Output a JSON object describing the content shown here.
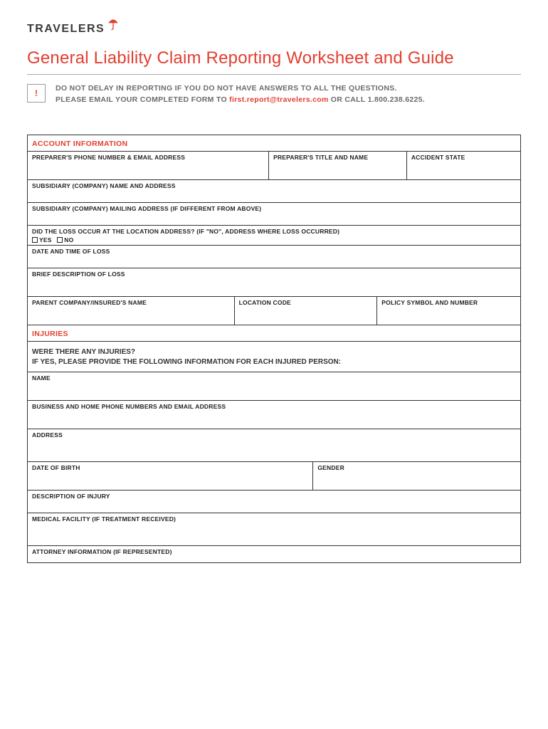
{
  "logo": {
    "text": "TRAVELERS"
  },
  "title": "General Liability Claim Reporting Worksheet and Guide",
  "notice": {
    "exclaim": "!",
    "line1": "DO NOT DELAY IN REPORTING IF YOU DO NOT HAVE ANSWERS TO ALL THE QUESTIONS.",
    "line2_pre": "PLEASE EMAIL YOUR COMPLETED FORM TO ",
    "email": "first.report@travelers.com",
    "line2_post": " OR CALL 1.800.238.6225."
  },
  "section1": {
    "header": "ACCOUNT INFORMATION",
    "preparer_phone_email": "PREPARER'S PHONE NUMBER & EMAIL ADDRESS",
    "preparer_title_name": "PREPARER'S TITLE AND NAME",
    "accident_state": "ACCIDENT STATE",
    "subsidiary_name_addr": "SUBSIDIARY (COMPANY) NAME AND ADDRESS",
    "subsidiary_mailing": "SUBSIDIARY (COMPANY) MAILING ADDRESS (IF DIFFERENT FROM ABOVE)",
    "loss_at_location": "DID THE LOSS OCCUR AT THE LOCATION ADDRESS? (IF \"NO\", ADDRESS WHERE LOSS OCCURRED)",
    "yes": "YES",
    "no": "NO",
    "date_time_loss": "DATE AND TIME OF LOSS",
    "brief_desc": "BRIEF DESCRIPTION OF LOSS",
    "parent_company": "PARENT COMPANY/INSURED'S NAME",
    "location_code": "LOCATION CODE",
    "policy_symbol": "POLICY SYMBOL AND NUMBER"
  },
  "section2": {
    "header": "INJURIES",
    "q_line1": "WERE THERE ANY INJURIES?",
    "q_line2": "IF YES, PLEASE PROVIDE THE FOLLOWING INFORMATION FOR EACH INJURED PERSON:",
    "name": "NAME",
    "contacts": "BUSINESS AND HOME PHONE NUMBERS AND EMAIL ADDRESS",
    "address": "ADDRESS",
    "dob": "DATE OF BIRTH",
    "gender": "GENDER",
    "desc_injury": "DESCRIPTION OF INJURY",
    "medical_facility": "MEDICAL FACILITY (IF TREATMENT RECEIVED)",
    "attorney": "ATTORNEY INFORMATION (IF REPRESENTED)"
  }
}
